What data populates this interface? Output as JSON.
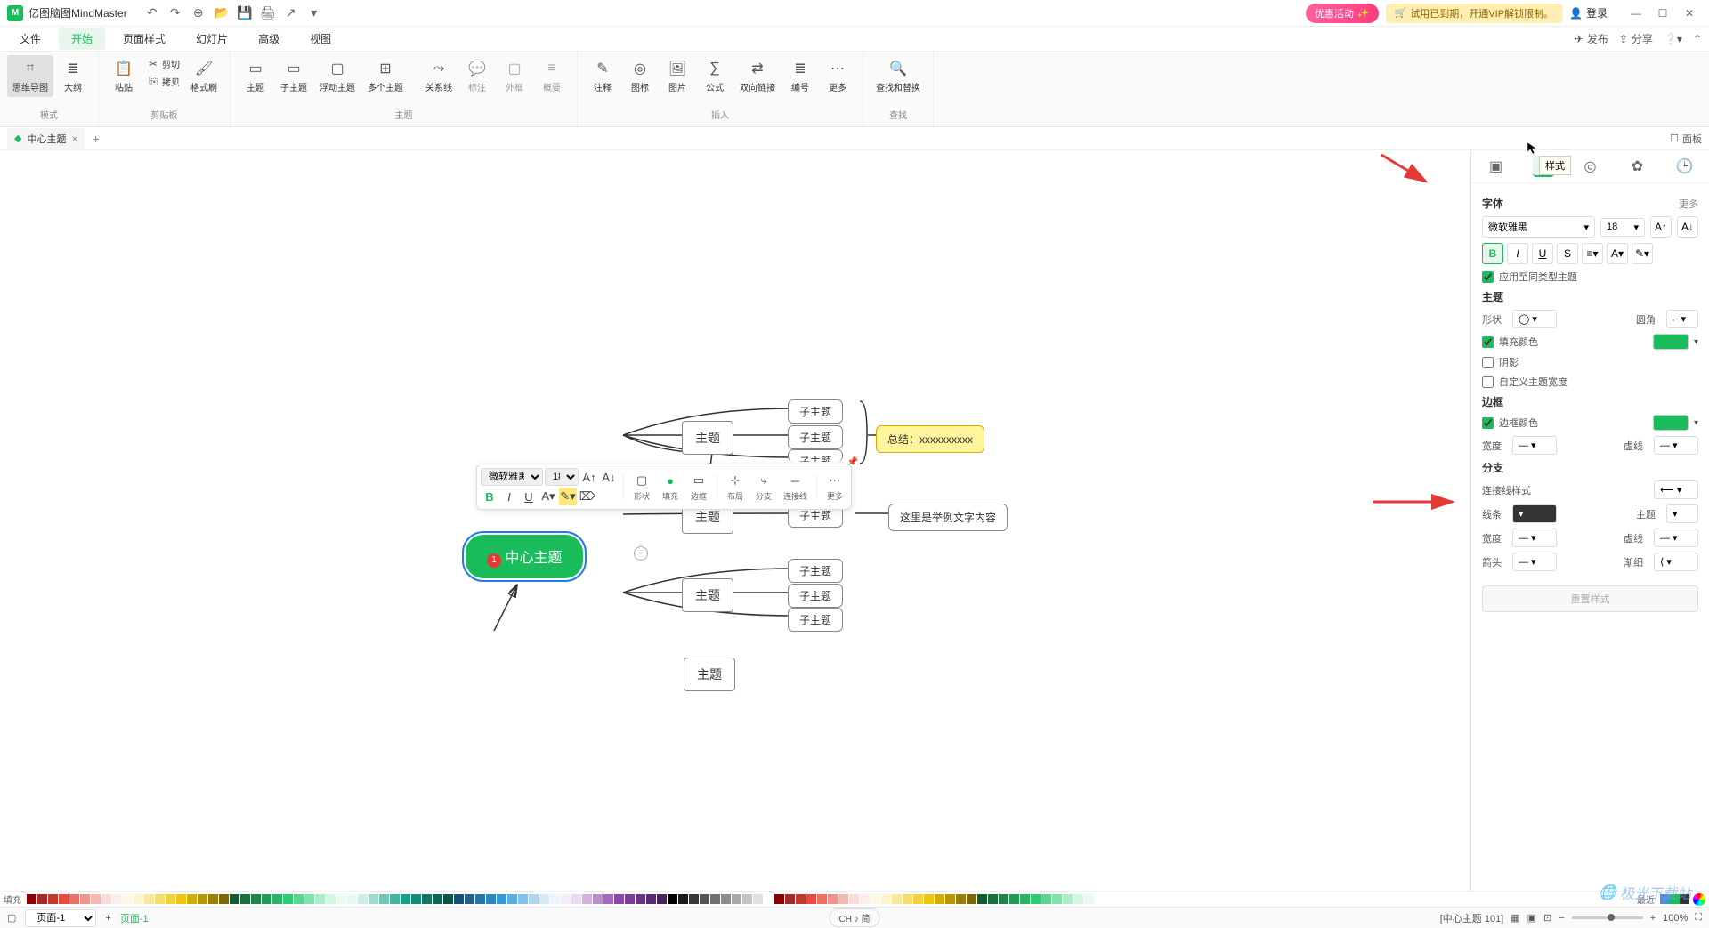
{
  "titlebar": {
    "app_name": "亿图脑图MindMaster",
    "promo": "优惠活动",
    "trial": "试用已到期，开通VIP解锁限制。",
    "login": "登录"
  },
  "menu": {
    "items": [
      "文件",
      "开始",
      "页面样式",
      "幻灯片",
      "高级",
      "视图"
    ],
    "active_index": 1,
    "publish": "发布",
    "share": "分享"
  },
  "ribbon": {
    "groups": [
      {
        "label": "模式",
        "items": [
          {
            "label": "思维导图",
            "icon": "⌘"
          },
          {
            "label": "大纲",
            "icon": "≡"
          }
        ]
      },
      {
        "label": "剪贴板",
        "items": [
          {
            "label": "粘贴",
            "icon": "📋"
          },
          {
            "label": "剪切",
            "icon": "✂",
            "small": true
          },
          {
            "label": "拷贝",
            "icon": "⎘",
            "small": true
          },
          {
            "label": "格式刷",
            "icon": "🖌"
          }
        ]
      },
      {
        "label": "主题",
        "items": [
          {
            "label": "主题",
            "icon": "▭"
          },
          {
            "label": "子主题",
            "icon": "▭"
          },
          {
            "label": "浮动主题",
            "icon": "▭"
          },
          {
            "label": "多个主题",
            "icon": "⊞"
          },
          {
            "label": "关系线",
            "icon": "⤳"
          },
          {
            "label": "标注",
            "icon": "💬"
          },
          {
            "label": "外框",
            "icon": "▢"
          },
          {
            "label": "概要",
            "icon": "}{"
          }
        ]
      },
      {
        "label": "插入",
        "items": [
          {
            "label": "注释",
            "icon": "✎"
          },
          {
            "label": "图标",
            "icon": "◎"
          },
          {
            "label": "图片",
            "icon": "🖼"
          },
          {
            "label": "公式",
            "icon": "Σ"
          },
          {
            "label": "双向链接",
            "icon": "⇄"
          },
          {
            "label": "编号",
            "icon": "≣"
          },
          {
            "label": "更多",
            "icon": "⋯"
          }
        ]
      },
      {
        "label": "查找",
        "items": [
          {
            "label": "查找和替换",
            "icon": "🔍"
          }
        ]
      }
    ]
  },
  "doctabs": {
    "tab_name": "中心主题",
    "panel_label": "面板"
  },
  "canvas": {
    "central": "中心主题",
    "central_badge": "1",
    "topics": [
      "主题",
      "主题",
      "主题",
      "主题"
    ],
    "subtopic": "子主题",
    "summary": "总结：xxxxxxxxxx",
    "example_text": "这里是举例文字内容"
  },
  "float_toolbar": {
    "font": "微软雅黑",
    "size": "18",
    "row1_icons": [
      "A+",
      "A-"
    ],
    "group_labels": [
      "形状",
      "填充",
      "边框",
      "布局",
      "分支",
      "连接线",
      "更多"
    ],
    "format_icons": [
      "B",
      "I",
      "U",
      "A",
      "A"
    ]
  },
  "sidepanel": {
    "tooltip": "样式",
    "font_section": "字体",
    "more": "更多",
    "font_name": "微软雅黑",
    "font_size": "18",
    "apply_same": "应用至同类型主题",
    "theme_section": "主题",
    "shape_label": "形状",
    "corner_label": "圆角",
    "fill_label": "填充颜色",
    "shadow_label": "阴影",
    "custom_width": "自定义主题宽度",
    "border_section": "边框",
    "border_color": "边框颜色",
    "width_label": "宽度",
    "dash_label": "虚线",
    "branch_section": "分支",
    "connector_style": "连接线样式",
    "line_color": "线条",
    "theme_label": "主题",
    "arrow_label": "箭头",
    "taper_label": "渐细",
    "reset": "重置样式"
  },
  "colorstrip": {
    "fill_label": "填充",
    "recent_label": "最近"
  },
  "statusbar": {
    "page_select": "页面-1",
    "page_tab": "页面-1",
    "lang": "CH ♪ 简",
    "context": "[中心主题 101]",
    "zoom": "100%"
  },
  "watermark": "极光下载站"
}
